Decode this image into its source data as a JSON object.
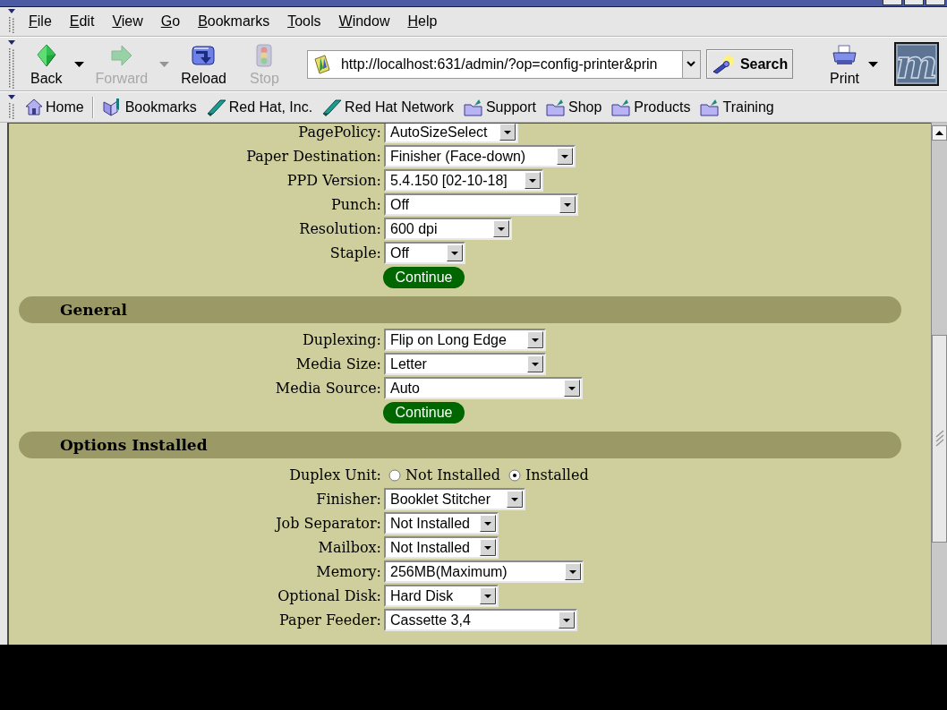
{
  "menu_bar": {
    "items": [
      "File",
      "Edit",
      "View",
      "Go",
      "Bookmarks",
      "Tools",
      "Window",
      "Help"
    ]
  },
  "navigation_toolbar": {
    "buttons": [
      {
        "kind": "back",
        "label": "Back",
        "disabled": false,
        "menu": true
      },
      {
        "kind": "forward",
        "label": "Forward",
        "disabled": true,
        "menu": true
      },
      {
        "kind": "reload",
        "label": "Reload",
        "disabled": false,
        "menu": false
      },
      {
        "kind": "stop",
        "label": "Stop",
        "disabled": true,
        "menu": false
      }
    ],
    "address_field": {
      "value": "http://localhost:631/admin/?op=config-printer&prin"
    },
    "search_button": {
      "label": "Search"
    },
    "print_button": {
      "label": "Print",
      "menu": true
    },
    "logo": {
      "letter": "m"
    }
  },
  "personal_toolbar": {
    "items": [
      {
        "kind": "home",
        "label": "Home"
      },
      {
        "kind": "bookmarks",
        "label": "Bookmarks"
      },
      {
        "kind": "link",
        "label": "Red Hat, Inc."
      },
      {
        "kind": "link",
        "label": "Red Hat Network"
      },
      {
        "kind": "folder",
        "label": "Support"
      },
      {
        "kind": "folder",
        "label": "Shop"
      },
      {
        "kind": "folder",
        "label": "Products"
      },
      {
        "kind": "folder",
        "label": "Training"
      }
    ]
  },
  "page": {
    "sections": [
      {
        "fields": [
          {
            "kind": "select",
            "label": "PagePolicy:",
            "value": "AutoSizeSelect"
          },
          {
            "kind": "select",
            "label": "Paper Destination:",
            "value": "Finisher (Face-down)"
          },
          {
            "kind": "select",
            "label": "PPD Version:",
            "value": "5.4.150 [02-10-18]"
          },
          {
            "kind": "select",
            "label": "Punch:",
            "value": "Off"
          },
          {
            "kind": "select",
            "label": "Resolution:",
            "value": "600 dpi"
          },
          {
            "kind": "select",
            "label": "Staple:",
            "value": "Off"
          }
        ],
        "submit": "Continue"
      },
      {
        "title": "General",
        "fields": [
          {
            "kind": "select",
            "label": "Duplexing:",
            "value": "Flip on Long Edge"
          },
          {
            "kind": "select",
            "label": "Media Size:",
            "value": "Letter"
          },
          {
            "kind": "select",
            "label": "Media Source:",
            "value": "Auto"
          }
        ],
        "submit": "Continue"
      },
      {
        "title": "Options Installed",
        "fields": [
          {
            "kind": "radio",
            "label": "Duplex Unit:",
            "options": [
              {
                "label": "Not Installed",
                "selected": false
              },
              {
                "label": "Installed",
                "selected": true
              }
            ]
          },
          {
            "kind": "select",
            "label": "Finisher:",
            "value": "Booklet Stitcher"
          },
          {
            "kind": "select",
            "label": "Job Separator:",
            "value": "Not Installed"
          },
          {
            "kind": "select",
            "label": "Mailbox:",
            "value": "Not Installed"
          },
          {
            "kind": "select",
            "label": "Memory:",
            "value": "256MB(Maximum)"
          },
          {
            "kind": "select",
            "label": "Optional Disk:",
            "value": "Hard Disk"
          },
          {
            "kind": "select",
            "label": "Paper Feeder:",
            "value": "Cassette 3,4"
          }
        ]
      }
    ]
  }
}
